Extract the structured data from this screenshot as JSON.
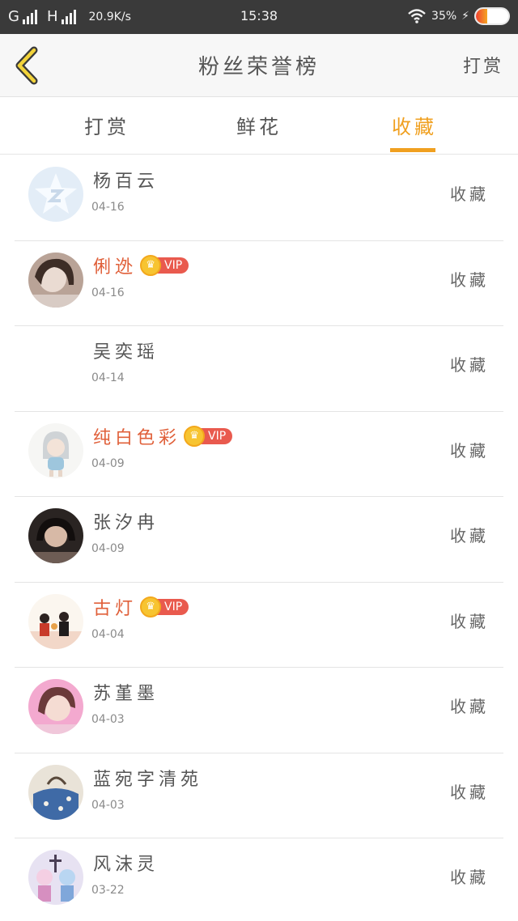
{
  "status_bar": {
    "network1": "G",
    "network2": "H",
    "speed": "20.9K/s",
    "time": "15:38",
    "battery_pct": "35%",
    "battery_level": 0.35
  },
  "header": {
    "title": "粉丝荣誉榜",
    "action": "打赏"
  },
  "tabs": [
    {
      "label": "打赏",
      "active": false
    },
    {
      "label": "鲜花",
      "active": false
    },
    {
      "label": "收藏",
      "active": true
    }
  ],
  "vip_label": "VIP",
  "rows": [
    {
      "name": "杨百云",
      "date": "04-16",
      "vip": false,
      "action": "收藏",
      "avatar": "qq-default-icon"
    },
    {
      "name": "俐迯",
      "date": "04-16",
      "vip": true,
      "action": "收藏",
      "avatar": "user-photo"
    },
    {
      "name": "吴奕瑶",
      "date": "04-14",
      "vip": false,
      "action": "收藏",
      "avatar": "blank"
    },
    {
      "name": "纯白色彩",
      "date": "04-09",
      "vip": true,
      "action": "收藏",
      "avatar": "anime-drawing"
    },
    {
      "name": "张汐冉",
      "date": "04-09",
      "vip": false,
      "action": "收藏",
      "avatar": "user-photo"
    },
    {
      "name": "古灯",
      "date": "04-04",
      "vip": true,
      "action": "收藏",
      "avatar": "illustration"
    },
    {
      "name": "苏堇墨",
      "date": "04-03",
      "vip": false,
      "action": "收藏",
      "avatar": "user-photo"
    },
    {
      "name": "蓝宛字清苑",
      "date": "04-03",
      "vip": false,
      "action": "收藏",
      "avatar": "user-photo"
    },
    {
      "name": "风沫灵",
      "date": "03-22",
      "vip": false,
      "action": "收藏",
      "avatar": "anime-drawing"
    }
  ]
}
